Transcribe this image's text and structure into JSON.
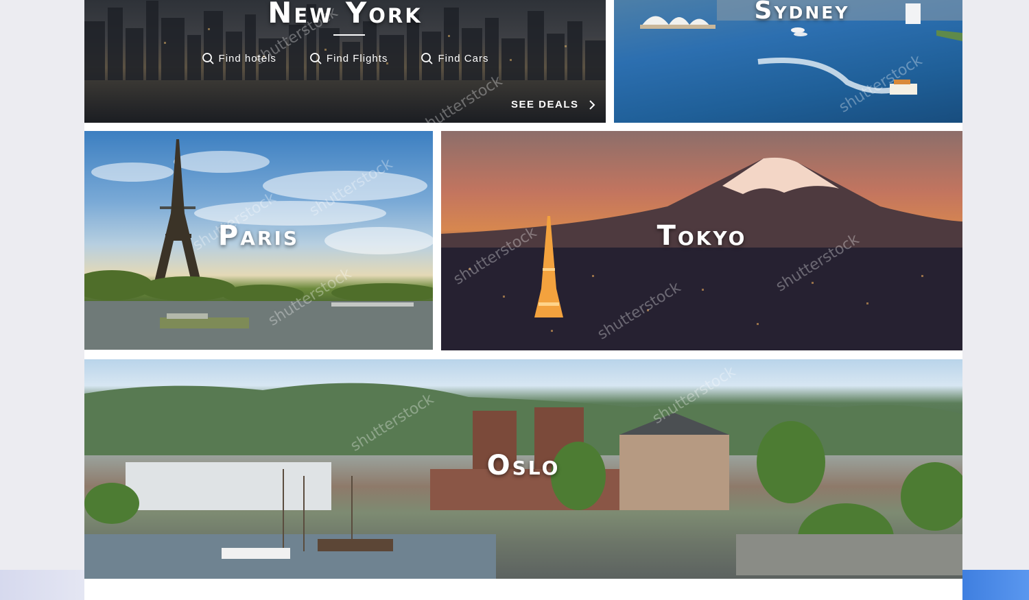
{
  "destinations": {
    "new_york": {
      "title": "New York",
      "links": {
        "hotels": "Find hotels",
        "flights": "Find Flights",
        "cars": "Find Cars"
      },
      "cta": "SEE DEALS"
    },
    "sydney": {
      "title": "Sydney"
    },
    "paris": {
      "title": "Paris"
    },
    "tokyo": {
      "title": "Tokyo"
    },
    "oslo": {
      "title": "Oslo"
    }
  },
  "icons": {
    "search": "search-icon",
    "chevron": "chevron-right-icon"
  },
  "colors": {
    "page_background": "#ececf1",
    "content_background": "#ffffff",
    "title_text": "#ffffff",
    "accent_blue": "#4a8ae6"
  }
}
